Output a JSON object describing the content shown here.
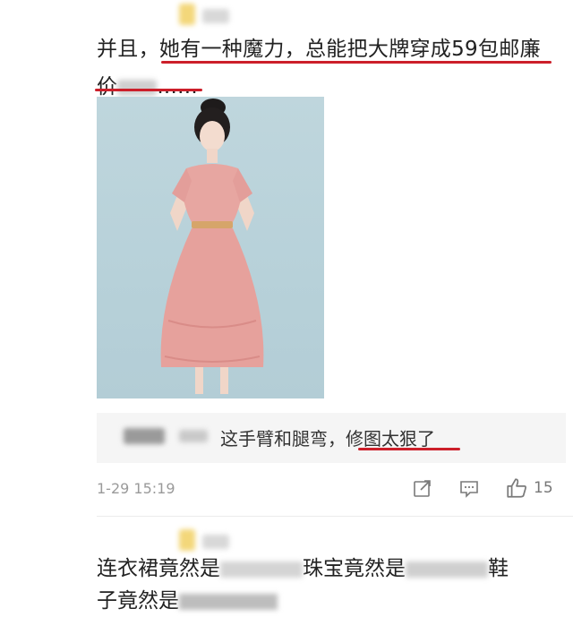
{
  "post1": {
    "line1_prefix": "并且，",
    "line1_highlight": "她有一种魔力，总能把大牌穿成59包邮廉",
    "line2_highlight": "价",
    "line2_suffix": "......"
  },
  "comment": {
    "text_plain": "这手臂和腿弯，",
    "text_highlight": "修图太狠了"
  },
  "meta": {
    "time": "1-29 15:19",
    "like_count": "15",
    "icons": [
      "share-icon",
      "comment-icon",
      "like-icon"
    ]
  },
  "post2": {
    "line1_a": "连衣裙竟然是",
    "line1_b": "珠宝竟然是",
    "line1_c": "鞋",
    "line2_a": "子竟然是"
  },
  "colors": {
    "underline": "#cc1f2a",
    "comment_bg": "#f5f5f5",
    "meta_text": "#9a9a9a"
  }
}
